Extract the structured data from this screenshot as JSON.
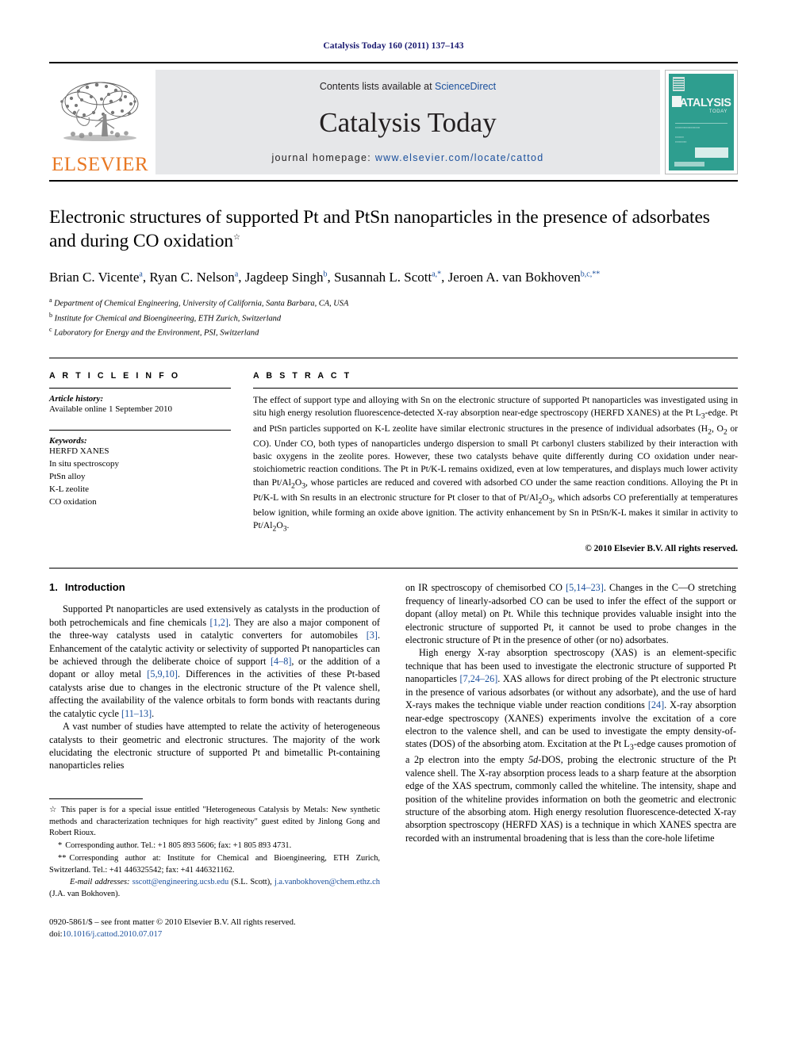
{
  "running_head": "Catalysis Today 160 (2011) 137–143",
  "masthead": {
    "contents_prefix": "Contents lists available at ",
    "sciencedirect": "ScienceDirect",
    "journal_title": "Catalysis Today",
    "homepage_prefix": "journal homepage: ",
    "homepage_url": "www.elsevier.com/locate/cattod",
    "publisher_wordmark": "ELSEVIER",
    "cover_title": "CATALYSIS",
    "cover_subtitle": "TODAY",
    "accent_orange": "#E87722",
    "link_blue": "#1a4f9c",
    "cover_teal": "#2e9e8f",
    "banner_gray": "#e6e7e9"
  },
  "article": {
    "title": "Electronic structures of supported Pt and PtSn nanoparticles in the presence of adsorbates and during CO oxidation",
    "title_footnote_mark": "☆",
    "authors_html": "Brian C. Vicente a, Ryan C. Nelson a, Jagdeep Singh b, Susannah L. Scott a,*, Jeroen A. van Bokhoven b,c,**",
    "authors": [
      {
        "name": "Brian C. Vicente",
        "marks": "a"
      },
      {
        "name": "Ryan C. Nelson",
        "marks": "a"
      },
      {
        "name": "Jagdeep Singh",
        "marks": "b"
      },
      {
        "name": "Susannah L. Scott",
        "marks": "a,*"
      },
      {
        "name": "Jeroen A. van Bokhoven",
        "marks": "b,c,**"
      }
    ],
    "affiliations": [
      {
        "label": "a",
        "text": "Department of Chemical Engineering, University of California, Santa Barbara, CA, USA"
      },
      {
        "label": "b",
        "text": "Institute for Chemical and Bioengineering, ETH Zurich, Switzerland"
      },
      {
        "label": "c",
        "text": "Laboratory for Energy and the Environment, PSI, Switzerland"
      }
    ]
  },
  "article_info": {
    "heading": "A R T I C L E  I N F O",
    "history_label": "Article history:",
    "history_value": "Available online 1 September 2010",
    "keywords_label": "Keywords:",
    "keywords": [
      "HERFD XANES",
      "In situ spectroscopy",
      "PtSn alloy",
      "K-L zeolite",
      "CO oxidation"
    ]
  },
  "abstract": {
    "heading": "A B S T R A C T",
    "text": "The effect of support type and alloying with Sn on the electronic structure of supported Pt nanoparticles was investigated using in situ high energy resolution fluorescence-detected X-ray absorption near-edge spectroscopy (HERFD XANES) at the Pt L3-edge. Pt and PtSn particles supported on K-L zeolite have similar electronic structures in the presence of individual adsorbates (H2, O2 or CO). Under CO, both types of nanoparticles undergo dispersion to small Pt carbonyl clusters stabilized by their interaction with basic oxygens in the zeolite pores. However, these two catalysts behave quite differently during CO oxidation under near-stoichiometric reaction conditions. The Pt in Pt/K-L remains oxidized, even at low temperatures, and displays much lower activity than Pt/Al2O3, whose particles are reduced and covered with adsorbed CO under the same reaction conditions. Alloying the Pt in Pt/K-L with Sn results in an electronic structure for Pt closer to that of Pt/Al2O3, which adsorbs CO preferentially at temperatures below ignition, while forming an oxide above ignition. The activity enhancement by Sn in PtSn/K-L makes it similar in activity to Pt/Al2O3.",
    "copyright": "© 2010 Elsevier B.V. All rights reserved."
  },
  "body": {
    "section_number": "1.",
    "section_title": "Introduction",
    "left_paragraphs": [
      "Supported Pt nanoparticles are used extensively as catalysts in the production of both petrochemicals and fine chemicals [1,2]. They are also a major component of the three-way catalysts used in catalytic converters for automobiles [3]. Enhancement of the catalytic activity or selectivity of supported Pt nanoparticles can be achieved through the deliberate choice of support [4–8], or the addition of a dopant or alloy metal [5,9,10]. Differences in the activities of these Pt-based catalysts arise due to changes in the electronic structure of the Pt valence shell, affecting the availability of the valence orbitals to form bonds with reactants during the catalytic cycle [11–13].",
      "A vast number of studies have attempted to relate the activity of heterogeneous catalysts to their geometric and electronic structures. The majority of the work elucidating the electronic structure of supported Pt and bimetallic Pt-containing nanoparticles relies"
    ],
    "right_paragraphs": [
      "on IR spectroscopy of chemisorbed CO [5,14–23]. Changes in the C—O stretching frequency of linearly-adsorbed CO can be used to infer the effect of the support or dopant (alloy metal) on Pt. While this technique provides valuable insight into the electronic structure of supported Pt, it cannot be used to probe changes in the electronic structure of Pt in the presence of other (or no) adsorbates.",
      "High energy X-ray absorption spectroscopy (XAS) is an element-specific technique that has been used to investigate the electronic structure of supported Pt nanoparticles [7,24–26]. XAS allows for direct probing of the Pt electronic structure in the presence of various adsorbates (or without any adsorbate), and the use of hard X-rays makes the technique viable under reaction conditions [24]. X-ray absorption near-edge spectroscopy (XANES) experiments involve the excitation of a core electron to the valence shell, and can be used to investigate the empty density-of-states (DOS) of the absorbing atom. Excitation at the Pt L3-edge causes promotion of a 2p electron into the empty 5d-DOS, probing the electronic structure of the Pt valence shell. The X-ray absorption process leads to a sharp feature at the absorption edge of the XAS spectrum, commonly called the whiteline. The intensity, shape and position of the whiteline provides information on both the geometric and electronic structure of the absorbing atom. High energy resolution fluorescence-detected X-ray absorption spectroscopy (HERFD XAS) is a technique in which XANES spectra are recorded with an instrumental broadening that is less than the core-hole lifetime"
    ]
  },
  "footnotes": {
    "special_issue": {
      "mark": "☆",
      "text": "This paper is for a special issue entitled \"Heterogeneous Catalysis by Metals: New synthetic methods and characterization techniques for high reactivity\" guest edited by Jinlong Gong and Robert Rioux."
    },
    "corresponding_1": {
      "mark": "*",
      "text": "Corresponding author. Tel.: +1 805 893 5606; fax: +1 805 893 4731."
    },
    "corresponding_2": {
      "mark": "**",
      "text": "Corresponding author at: Institute for Chemical and Bioengineering, ETH Zurich, Switzerland. Tel.: +41 446325542; fax: +41 446321162."
    },
    "email_label": "E-mail addresses:",
    "email_1": "sscott@engineering.ucsb.edu",
    "email_1_owner": "(S.L. Scott),",
    "email_2": "j.a.vanbokhoven@chem.ethz.ch",
    "email_2_owner": "(J.A. van Bokhoven)."
  },
  "imprint": {
    "line1": "0920-5861/$ – see front matter © 2010 Elsevier B.V. All rights reserved.",
    "doi_label": "doi:",
    "doi_value": "10.1016/j.cattod.2010.07.017"
  }
}
